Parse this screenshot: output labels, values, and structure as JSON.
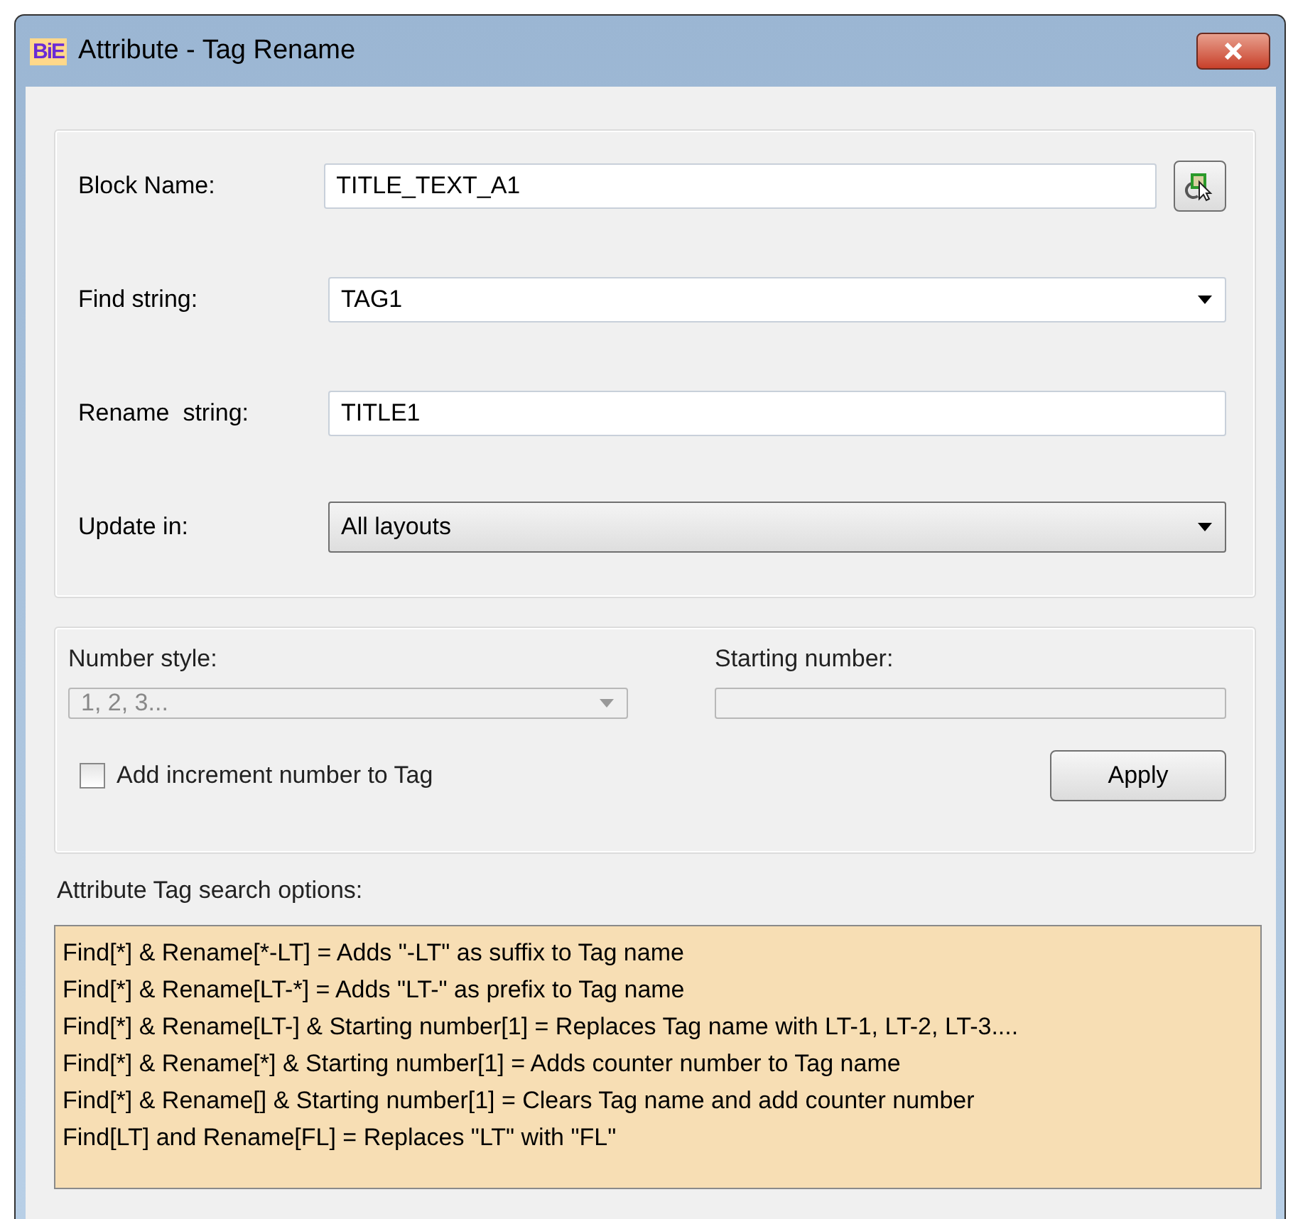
{
  "window": {
    "title": "Attribute - Tag Rename",
    "app_icon": "BiE"
  },
  "fields": [
    {
      "kind": "text",
      "label": "Block Name:",
      "value": "TITLE_TEXT_A1",
      "pick_button": true
    },
    {
      "kind": "combo",
      "label": "Find string:",
      "value": "TAG1"
    },
    {
      "kind": "text",
      "label": "Rename  string:",
      "value": "TITLE1",
      "pick_button": false
    },
    {
      "kind": "dropdown",
      "label": "Update in:",
      "value": "All layouts"
    }
  ],
  "numbering": {
    "number_style": {
      "label": "Number style:",
      "value": "1, 2, 3...",
      "disabled": true
    },
    "starting_number": {
      "label": "Starting number:",
      "disabled": true
    },
    "increment_checkbox": {
      "label": "Add increment number to Tag",
      "checked": false
    },
    "apply_button": "Apply"
  },
  "search_options": {
    "label": "Attribute Tag search options:",
    "lines": [
      "Find[*] & Rename[*-LT] = Adds \"-LT\" as suffix to Tag name",
      "Find[*] & Rename[LT-*] = Adds \"LT-\" as prefix to Tag name",
      "Find[*] & Rename[LT-] & Starting number[1] = Replaces Tag name with LT-1, LT-2, LT-3....",
      "Find[*] & Rename[*] & Starting number[1] = Adds counter number to Tag name",
      "Find[*] & Rename[] & Starting number[1] = Clears Tag name and add counter number",
      "Find[LT] and Rename[FL] = Replaces \"LT\" with \"FL\""
    ]
  }
}
